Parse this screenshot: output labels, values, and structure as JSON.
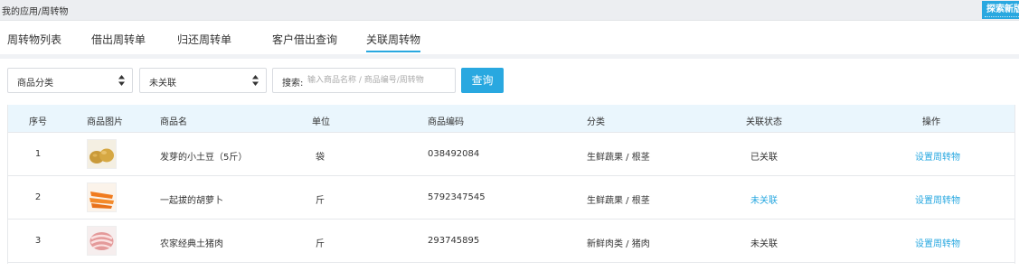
{
  "breadcrumb": "我的应用/周转物",
  "corner_button": "探索新版",
  "tabs": [
    {
      "label": "周转物列表"
    },
    {
      "label": "借出周转单"
    },
    {
      "label": "归还周转单"
    },
    {
      "label": "客户借出查询"
    },
    {
      "label": "关联周转物",
      "active": true
    }
  ],
  "filters": {
    "category": {
      "selected": "商品分类"
    },
    "relation": {
      "selected": "未关联"
    },
    "search": {
      "label": "搜索:",
      "placeholder": "输入商品名称 / 商品编号/周转物",
      "value": ""
    },
    "query_button": "查询"
  },
  "table": {
    "columns": [
      "序号",
      "商品图片",
      "商品名",
      "单位",
      "商品编码",
      "分类",
      "关联状态",
      "操作"
    ],
    "rows": [
      {
        "index": "1",
        "image": "potato-image",
        "name": "发芽的小土豆（5斤）",
        "unit": "袋",
        "code": "038492084",
        "category": "生鲜蔬果 / 根茎",
        "status": "已关联",
        "action": "设置周转物"
      },
      {
        "index": "2",
        "image": "carrot-image",
        "name": "一起拔的胡萝卜",
        "unit": "斤",
        "code": "5792347545",
        "category": "生鲜蔬果 / 根茎",
        "status": "未关联",
        "action": "设置周转物"
      },
      {
        "index": "3",
        "image": "pork-image",
        "name": "农家经典土猪肉",
        "unit": "斤",
        "code": "293745895",
        "category": "新鲜肉类 / 猪肉",
        "status": "未关联",
        "action": "设置周转物"
      }
    ]
  },
  "colors": {
    "accent": "#29a8e0",
    "header_bg": "#eaf6fd",
    "topbar_bg": "#eceef1"
  }
}
